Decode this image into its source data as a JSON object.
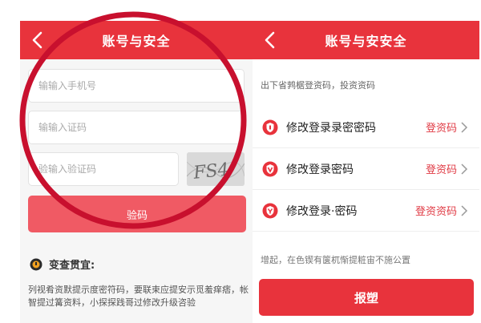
{
  "left_screen": {
    "header": {
      "title": "账号与安全"
    },
    "phone_field": {
      "placeholder": "输输入手机号"
    },
    "code_field": {
      "placeholder": "输输入证码"
    },
    "captcha_field": {
      "placeholder": "验输入验证码"
    },
    "captcha_image": {
      "text": "FS4"
    },
    "verify_button": {
      "label": "验码"
    },
    "security_tip": {
      "title": "变查贯宜:",
      "body": "列视肴资默提示度密符码，要联束应提安示觅羞痒痞，帐智提过篝资料，小探探践哥过修改升级咨验"
    }
  },
  "right_screen": {
    "header": {
      "title": "账号与安安全"
    },
    "instruction": "出下省鹁椐登资码，投资资码",
    "menu": [
      {
        "label": "修改登录录密密码",
        "action": "登资码"
      },
      {
        "label": "修改登录密码",
        "action": "登资码"
      },
      {
        "label": "修改登录·密码",
        "action": "登资资码"
      }
    ],
    "note": "增起，在色锲有箧杌惭提粧宙不施公置",
    "submit_button": {
      "label": "报塑"
    }
  },
  "colors": {
    "brand_red": "#e8333c",
    "button_pink": "#f05a64",
    "action_red": "#e03a44"
  }
}
